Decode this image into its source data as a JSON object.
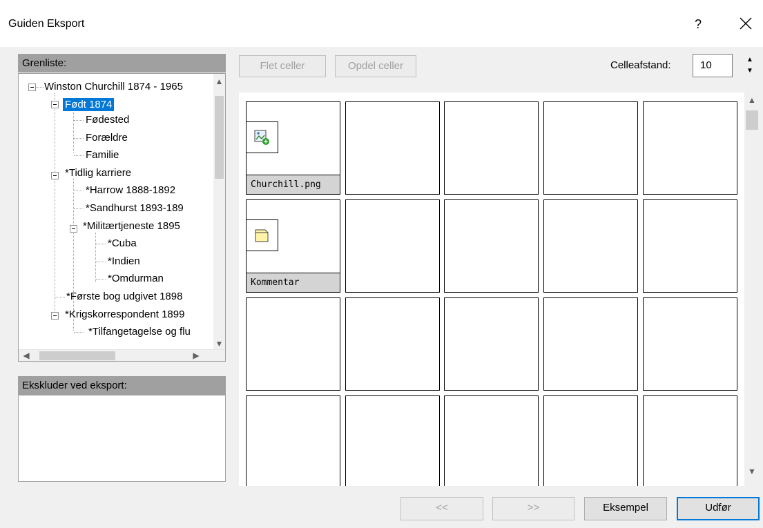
{
  "window": {
    "title": "Guiden Eksport",
    "help": "?"
  },
  "tree_panel": {
    "header": "Grenliste:",
    "items": [
      {
        "label": "Winston Churchill 1874 - 1965"
      },
      {
        "label": "Født 1874"
      },
      {
        "label": "Fødested"
      },
      {
        "label": "Forældre"
      },
      {
        "label": "Familie"
      },
      {
        "label": "*Tidlig karriere"
      },
      {
        "label": "*Harrow 1888-1892"
      },
      {
        "label": "*Sandhurst 1893-189"
      },
      {
        "label": "*Militærtjeneste 1895"
      },
      {
        "label": "*Cuba"
      },
      {
        "label": "*Indien"
      },
      {
        "label": "*Omdurman"
      },
      {
        "label": "*Første bog udgivet 1898"
      },
      {
        "label": "*Krigskorrespondent 1899"
      },
      {
        "label": "*Tilfangetagelse og flu"
      }
    ],
    "selected_index": 1
  },
  "exclude_panel": {
    "header": "Ekskluder ved eksport:"
  },
  "toolbar": {
    "merge_label": "Flet celler",
    "split_label": "Opdel celler",
    "spacing_label": "Celleafstand:",
    "spacing_value": "10"
  },
  "grid": {
    "cells": [
      {
        "caption": "Churchill.png",
        "icon": "image-add-icon"
      },
      {
        "caption": "Kommentar",
        "icon": "note-icon"
      }
    ]
  },
  "footer": {
    "back_label": "<<",
    "next_label": ">>",
    "preview_label": "Eksempel",
    "finish_label": "Udfør"
  },
  "colors": {
    "accent": "#0078d7",
    "panel_header": "#a0a0a0"
  }
}
